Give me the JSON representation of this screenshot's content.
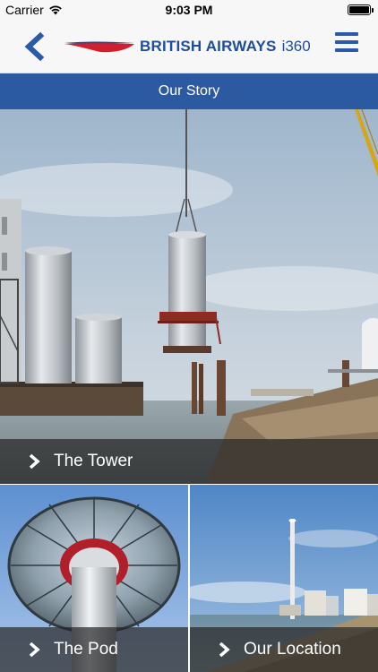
{
  "status_bar": {
    "carrier": "Carrier",
    "time": "9:03 PM",
    "wifi_icon": "wifi-icon",
    "battery_icon": "battery-icon"
  },
  "nav": {
    "back_icon": "chevron-left-icon",
    "brand_name": "BRITISH AIRWAYS",
    "brand_sub": "i360",
    "menu_icon": "hamburger-menu-icon",
    "accent_color": "#2c5aa0"
  },
  "section": {
    "title": "Our Story"
  },
  "tiles": [
    {
      "label": "The Tower",
      "icon": "chevron-right-icon"
    },
    {
      "label": "The Pod",
      "icon": "chevron-right-icon"
    },
    {
      "label": "Our Location",
      "icon": "chevron-right-icon"
    }
  ]
}
